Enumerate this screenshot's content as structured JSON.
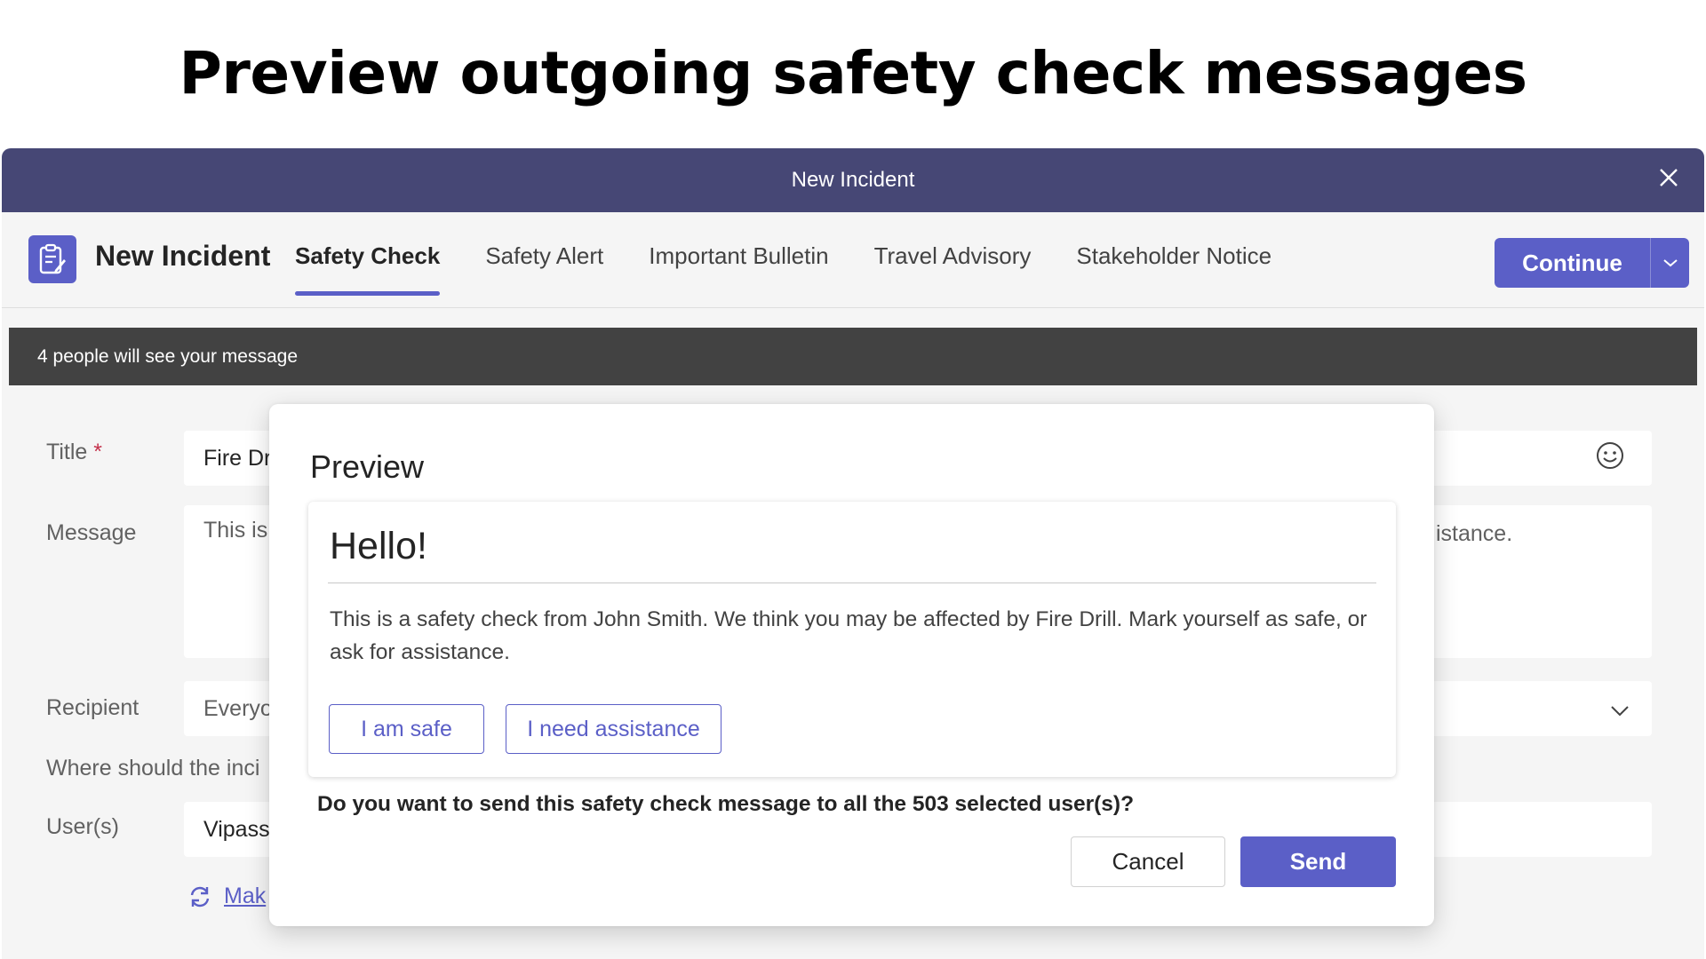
{
  "slide": {
    "title": "Preview outgoing safety check messages"
  },
  "window": {
    "title": "New Incident"
  },
  "header": {
    "app_name": "New Incident",
    "tabs": [
      {
        "label": "Safety Check",
        "active": true
      },
      {
        "label": "Safety Alert",
        "active": false
      },
      {
        "label": "Important Bulletin",
        "active": false
      },
      {
        "label": "Travel Advisory",
        "active": false
      },
      {
        "label": "Stakeholder Notice",
        "active": false
      }
    ],
    "continue_label": "Continue"
  },
  "notice": {
    "text": "4 people will see your message"
  },
  "form": {
    "title_label": "Title",
    "title_required_mark": "*",
    "title_value": "Fire Dr",
    "message_label": "Message",
    "message_value": "This is a",
    "message_value_tail": "istance.",
    "recipient_label": "Recipient",
    "recipient_value": "Everyo",
    "where_label": "Where should the inci",
    "users_label": "User(s)",
    "users_value": "Vipassa",
    "make_link": "Mak"
  },
  "modal": {
    "title": "Preview",
    "card": {
      "heading": "Hello!",
      "body": "This is a safety check from John Smith. We think you may be affected by Fire Drill. Mark yourself as safe, or ask for assistance.",
      "safe_button": "I am safe",
      "assist_button": "I need assistance"
    },
    "question": "Do you want to send this safety check message to all the 503 selected user(s)?",
    "cancel_label": "Cancel",
    "send_label": "Send"
  },
  "icons": {
    "close": "close-icon",
    "app": "clipboard-icon",
    "continue_dropdown": "chevron-down-icon",
    "emoji": "emoji-icon",
    "recipient_dropdown": "chevron-down-icon",
    "make_link": "refresh-icon"
  },
  "colors": {
    "titlebar": "#464775",
    "accent": "#5b5fc7",
    "notice_bar": "#424242",
    "required": "#c4314b"
  }
}
